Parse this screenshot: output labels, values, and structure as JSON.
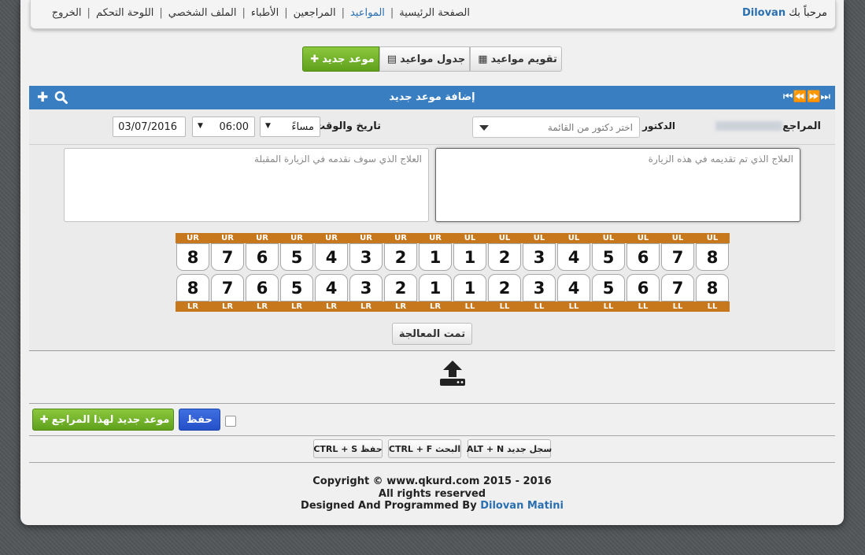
{
  "nav": {
    "welcome_text": "مرحباً بك",
    "username": "Dilovan",
    "links": [
      "الصفحة الرئيسية",
      "المواعيد",
      "المراجعين",
      "الأطباء",
      "الملف الشخصي",
      "اللوحة التحكم",
      "الخروج"
    ]
  },
  "toolbar": {
    "calendar_label": "تقويم مواعيد",
    "table_label": "جدول مواعيد",
    "new_label": "موعد جديد"
  },
  "form": {
    "title": "إضافة موعد جديد",
    "patient_label": "المراجع",
    "doctor_label": "الدكتور",
    "doctor_placeholder": "اختر دكتور من القائمة",
    "datetime_label": "تاريخ والوقت",
    "period_value": "مساءً",
    "time_value": "06:00",
    "date_value": "03/07/2016",
    "treatment_done_placeholder": "العلاج الذي تم تقديمه في هذه الزيارة",
    "treatment_next_placeholder": "العلاج الذي سوف نقدمه في الزيارة المقبلة",
    "processed_label": "تمت المعالجة",
    "new_for_patient_label": "موعد جديد لهذا المراجع",
    "save_label": "حفظ"
  },
  "teeth": {
    "upper_quadrants": [
      "UR",
      "UR",
      "UR",
      "UR",
      "UR",
      "UR",
      "UR",
      "UR",
      "UL",
      "UL",
      "UL",
      "UL",
      "UL",
      "UL",
      "UL",
      "UL"
    ],
    "upper_numbers": [
      "8",
      "7",
      "6",
      "5",
      "4",
      "3",
      "2",
      "1",
      "1",
      "2",
      "3",
      "4",
      "5",
      "6",
      "7",
      "8"
    ],
    "lower_numbers": [
      "8",
      "7",
      "6",
      "5",
      "4",
      "3",
      "2",
      "1",
      "1",
      "2",
      "3",
      "4",
      "5",
      "6",
      "7",
      "8"
    ],
    "lower_quadrants": [
      "LR",
      "LR",
      "LR",
      "LR",
      "LR",
      "LR",
      "LR",
      "LR",
      "LL",
      "LL",
      "LL",
      "LL",
      "LL",
      "LL",
      "LL",
      "LL"
    ]
  },
  "shortcuts": {
    "save": "CTRL + S حفظ",
    "search": "CTRL + F البحث",
    "new": "ALT + N سجل جديد"
  },
  "footer": {
    "copyright": "Copyright © www.qkurd.com 2015 - 2016",
    "rights": "All rights reserved",
    "designed": "Designed And Programmed By",
    "author": "Dilovan Matini"
  },
  "colors": {
    "titlebar": "#3a7ec2",
    "tooth_strip": "#c8781c",
    "green_button": "#6bb02a",
    "blue_button": "#2c5ad6"
  }
}
